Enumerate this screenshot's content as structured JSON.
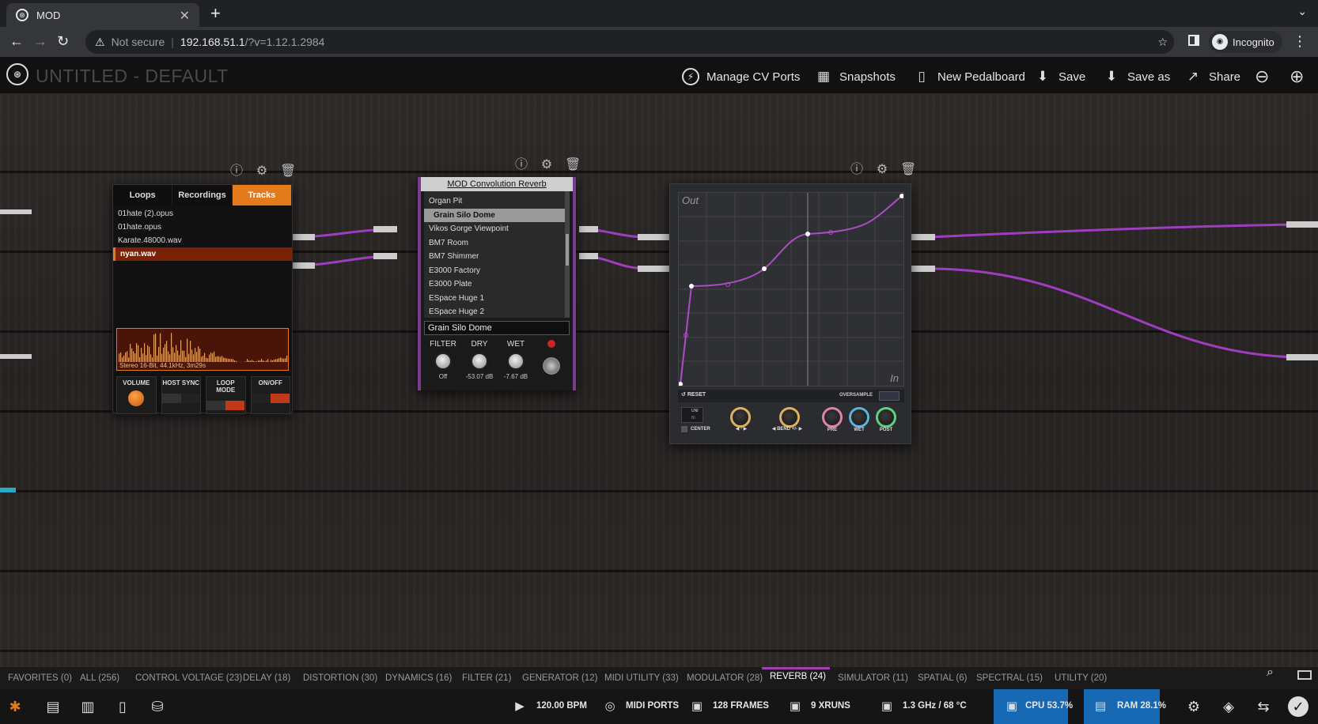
{
  "browser": {
    "tab_title": "MOD",
    "tab_close": "✕",
    "new_tab": "+",
    "url_warning": "Not secure",
    "url_host": "192.168.51.1",
    "url_path": "/?v=1.12.1.2984",
    "profile_label": "Incognito"
  },
  "header": {
    "pedalboard_title": "UNTITLED - DEFAULT",
    "buttons": {
      "cv_ports": "Manage CV Ports",
      "snapshots": "Snapshots",
      "new_pedalboard": "New Pedalboard",
      "save": "Save",
      "save_as": "Save as",
      "share": "Share"
    }
  },
  "player": {
    "tabs": [
      "Loops",
      "Recordings",
      "Tracks"
    ],
    "active_tab": "Tracks",
    "files": [
      "01hate (2).opus",
      "01hate.opus",
      "Karate.48000.wav",
      "nyan.wav"
    ],
    "selected_file": "nyan.wav",
    "file_info": "Stereo 16-Bit, 44.1kHz, 3m29s",
    "controls": {
      "volume": "VOLUME",
      "host_sync": "HOST SYNC",
      "loop_mode": "LOOP MODE",
      "on_off": "ON/OFF"
    }
  },
  "conv": {
    "title": "MOD Convolution Reverb",
    "items": [
      "Organ Pit",
      "Grain Silo Dome",
      "Vikos Gorge Viewpoint",
      "BM7 Room",
      "BM7 Shimmer",
      "E3000 Factory",
      "E3000 Plate",
      "ESpace Huge 1",
      "ESpace Huge 2"
    ],
    "selected_item": "Grain Silo Dome",
    "current": "Grain Silo Dome",
    "knobs": [
      {
        "label": "FILTER",
        "value": "Off"
      },
      {
        "label": "DRY",
        "value": "-53.07 dB"
      },
      {
        "label": "WET",
        "value": "-7.67 dB"
      }
    ]
  },
  "curve": {
    "out_label": "Out",
    "in_label": "In",
    "reset": "RESET",
    "oversample": "OVERSAMPLE",
    "uni": "UNI",
    "bi": "BI",
    "center": "CENTER",
    "bend_label": "BEND +/-",
    "dash": "-",
    "knob_labels": [
      "PRE",
      "WET",
      "POST"
    ]
  },
  "categories": [
    "FAVORITES (0)",
    "ALL (256)",
    "CONTROL VOLTAGE (23)",
    "DELAY (18)",
    "DISTORTION (30)",
    "DYNAMICS (16)",
    "FILTER (21)",
    "GENERATOR (12)",
    "MIDI UTILITY (33)",
    "MODULATOR (28)",
    "REVERB (24)",
    "SIMULATOR (11)",
    "SPATIAL (6)",
    "SPECTRAL (15)",
    "UTILITY (20)"
  ],
  "active_category": "REVERB (24)",
  "status": {
    "bpm": "120.00 BPM",
    "midi": "MIDI PORTS",
    "frames": "128 FRAMES",
    "xruns": "9 XRUNS",
    "cpu_freq": "1.3 GHz / 68 °C",
    "cpu": "CPU 53.7%",
    "ram": "RAM 28.1%"
  },
  "colors": {
    "cable": "#a03cc0",
    "accent_orange": "#e37a1b",
    "status_blue": "#1769b3"
  }
}
